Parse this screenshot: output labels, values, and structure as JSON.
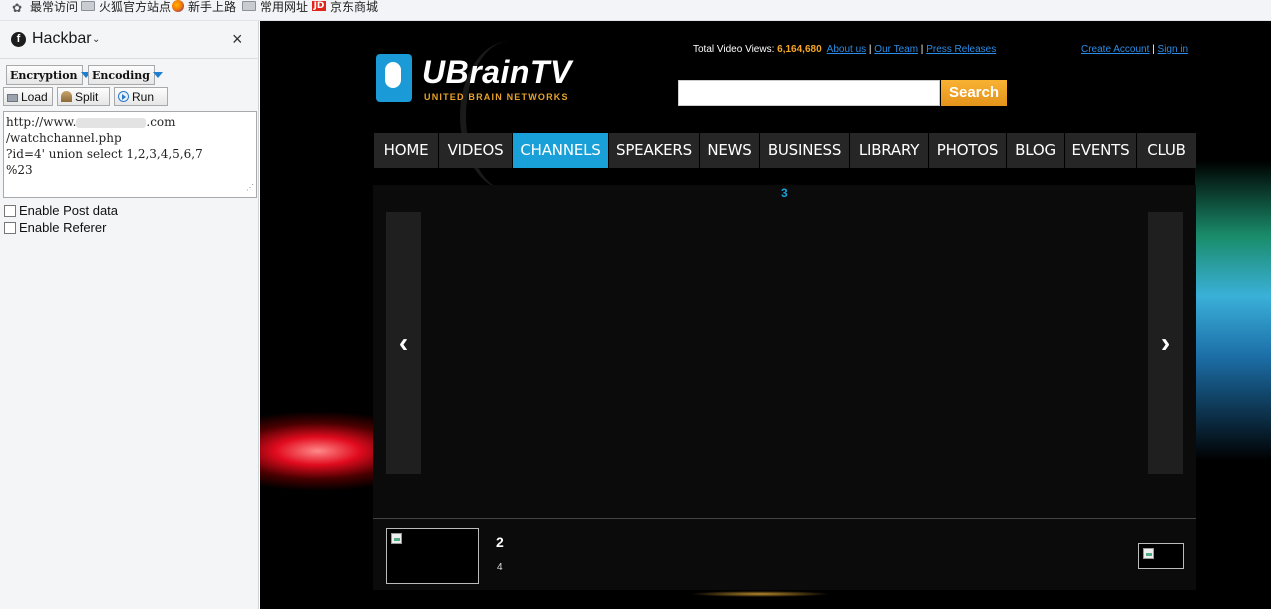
{
  "bookmarks": [
    {
      "label": "最常访问",
      "icon": "star-icon"
    },
    {
      "label": "火狐官方站点",
      "icon": "folder-icon"
    },
    {
      "label": "新手上路",
      "icon": "firefox-icon"
    },
    {
      "label": "常用网址",
      "icon": "folder-icon"
    },
    {
      "label": "京东商城",
      "icon": "jd-icon"
    }
  ],
  "hackbar": {
    "title": "Hackbar",
    "chevron": "⌄",
    "close": "×",
    "encryption_label": "Encryption",
    "encoding_label": "Encoding",
    "load_label": "Load",
    "split_label": "Split",
    "run_label": "Run",
    "url_line1_prefix": "http://www.",
    "url_line1_suffix": ".com",
    "url_line2": "/watchchannel.php",
    "url_line3": "?id=4' union select 1,2,3,4,5,6,7",
    "url_line4": "%23",
    "post_label": "Enable Post data",
    "referer_label": "Enable Referer"
  },
  "site": {
    "logo_text": "UBrainTV",
    "logo_tagline": "United Brain Networks",
    "stats_prefix": "Total Video Views: ",
    "stats_value": "6,164,680",
    "about_link": "About us",
    "team_link": "Our Team",
    "press_link": "Press Releases",
    "sep": " | ",
    "create_account": "Create Account",
    "sign_in": "Sign in",
    "search_button": "Search",
    "search_placeholder": "",
    "nav": [
      "HOME",
      "VIDEOS",
      "CHANNELS",
      "SPEAKERS",
      "NEWS",
      "BUSINESS",
      "LIBRARY",
      "PHOTOS",
      "BLOG",
      "EVENTS",
      "CLUB"
    ],
    "nav_active": "CHANNELS",
    "slide_number": "3",
    "prev_arrow": "‹",
    "next_arrow": "›",
    "thumb_title": "2",
    "thumb_sub": "4"
  },
  "colors": {
    "accent": "#1aa0d8",
    "search_orange": "#f0a324",
    "stat_orange": "#f5a623",
    "link": "#2a8ce6"
  }
}
